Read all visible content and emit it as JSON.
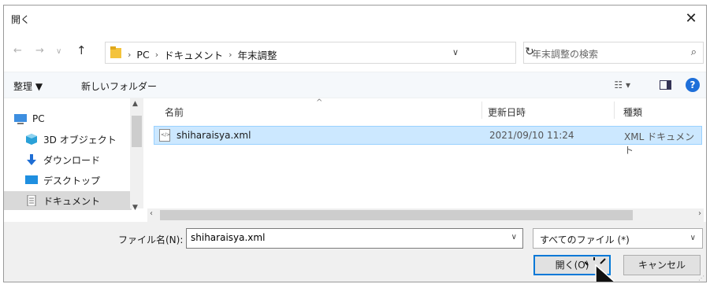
{
  "window": {
    "title": "開く",
    "close_icon": "close-icon"
  },
  "address": {
    "crumbs": [
      "PC",
      "ドキュメント",
      "年末調整"
    ],
    "search_placeholder": "年末調整の検索"
  },
  "toolbar": {
    "organize": "整理 ▼",
    "new_folder": "新しいフォルダー",
    "view_icon": "view-options-icon",
    "help": "?"
  },
  "nav": {
    "items": [
      {
        "label": "PC",
        "icon": "computer-icon",
        "color": "#3d8ee0"
      },
      {
        "label": "3D オブジェクト",
        "icon": "cube-icon",
        "color": "#2aa1d8"
      },
      {
        "label": "ダウンロード",
        "icon": "download-icon",
        "color": "#1f6ed4"
      },
      {
        "label": "デスクトップ",
        "icon": "desktop-icon",
        "color": "#1f8fe0"
      },
      {
        "label": "ドキュメント",
        "icon": "document-icon",
        "color": "#777777"
      }
    ],
    "selected": "ドキュメント"
  },
  "list": {
    "columns": [
      "名前",
      "更新日時",
      "種類"
    ],
    "rows": [
      {
        "name": "shiharaisya.xml",
        "modified": "2021/09/10 11:24",
        "type": "XML ドキュメント"
      }
    ]
  },
  "footer": {
    "filename_label": "ファイル名(N):",
    "filename_value": "shiharaisya.xml",
    "filetype": "すべてのファイル (*)",
    "open_label": "開く(O)",
    "cancel_label": "キャンセル"
  },
  "colors": {
    "accent": "#0078d7",
    "selection": "#cce8ff"
  }
}
